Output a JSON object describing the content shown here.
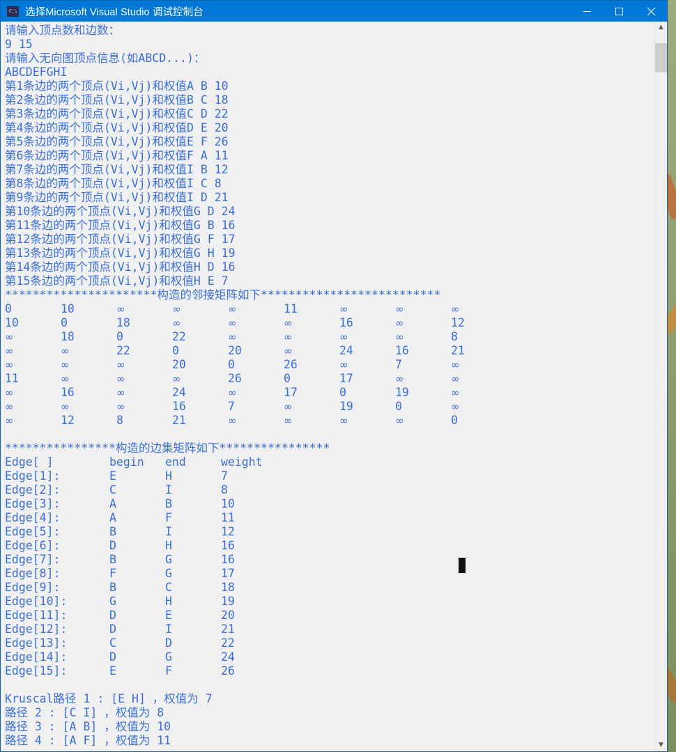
{
  "window": {
    "title": "选择Microsoft Visual Studio 调试控制台",
    "icon_label": "C:\\",
    "icon_name": "console-app-icon",
    "minimize_label": "最小化",
    "maximize_label": "最大化",
    "close_label": "关闭",
    "titlebar_color": "#0078d7",
    "text_color": "#3a6fd8",
    "background_color": "#f0f0f0"
  },
  "scrollbar": {
    "up_arrow": "▲",
    "down_arrow": "▼"
  },
  "console": {
    "prompt_vertices_edges": "请输入顶点数和边数：",
    "input_vertices_edges": "9 15",
    "prompt_vertex_info": "请输入无向图顶点信息(如ABCD...)：",
    "input_vertex_info": "ABCDEFGHI",
    "edge_prompts": [
      "第1条边的两个顶点(Vi,Vj)和权值A B 10",
      "第2条边的两个顶点(Vi,Vj)和权值B C 18",
      "第3条边的两个顶点(Vi,Vj)和权值C D 22",
      "第4条边的两个顶点(Vi,Vj)和权值D E 20",
      "第5条边的两个顶点(Vi,Vj)和权值E F 26",
      "第6条边的两个顶点(Vi,Vj)和权值F A 11",
      "第7条边的两个顶点(Vi,Vj)和权值I B 12",
      "第8条边的两个顶点(Vi,Vj)和权值I C 8",
      "第9条边的两个顶点(Vi,Vj)和权值I D 21",
      "第10条边的两个顶点(Vi,Vj)和权值G D 24",
      "第11条边的两个顶点(Vi,Vj)和权值G B 16",
      "第12条边的两个顶点(Vi,Vj)和权值G F 17",
      "第13条边的两个顶点(Vi,Vj)和权值G H 19",
      "第14条边的两个顶点(Vi,Vj)和权值H D 16",
      "第15条边的两个顶点(Vi,Vj)和权值H E 7"
    ],
    "adjacency_header": "**********************构造的邻接矩阵如下**************************",
    "edgeset_header": "****************构造的边集矩阵如下****************",
    "edge_table_header": {
      "index": "Edge[ ]",
      "begin": "begin",
      "end": "end",
      "weight": "weight"
    },
    "edge_table_rows": [
      {
        "index": "Edge[1]:",
        "begin": "E",
        "end": "H",
        "weight": "7"
      },
      {
        "index": "Edge[2]:",
        "begin": "C",
        "end": "I",
        "weight": "8"
      },
      {
        "index": "Edge[3]:",
        "begin": "A",
        "end": "B",
        "weight": "10"
      },
      {
        "index": "Edge[4]:",
        "begin": "A",
        "end": "F",
        "weight": "11"
      },
      {
        "index": "Edge[5]:",
        "begin": "B",
        "end": "I",
        "weight": "12"
      },
      {
        "index": "Edge[6]:",
        "begin": "D",
        "end": "H",
        "weight": "16"
      },
      {
        "index": "Edge[7]:",
        "begin": "B",
        "end": "G",
        "weight": "16"
      },
      {
        "index": "Edge[8]:",
        "begin": "F",
        "end": "G",
        "weight": "17"
      },
      {
        "index": "Edge[9]:",
        "begin": "B",
        "end": "C",
        "weight": "18"
      },
      {
        "index": "Edge[10]:",
        "begin": "G",
        "end": "H",
        "weight": "19"
      },
      {
        "index": "Edge[11]:",
        "begin": "D",
        "end": "E",
        "weight": "20"
      },
      {
        "index": "Edge[12]:",
        "begin": "D",
        "end": "I",
        "weight": "21"
      },
      {
        "index": "Edge[13]:",
        "begin": "C",
        "end": "D",
        "weight": "22"
      },
      {
        "index": "Edge[14]:",
        "begin": "D",
        "end": "G",
        "weight": "24"
      },
      {
        "index": "Edge[15]:",
        "begin": "E",
        "end": "F",
        "weight": "26"
      }
    ],
    "kruskal_lines": [
      "Kruscal路径 1 : [E H] ，权值为 7",
      "路径 2 : [C I] ，权值为 8",
      "路径 3 : [A B] ，权值为 10",
      "路径 4 : [A F] ，权值为 11"
    ]
  },
  "chart_data": {
    "type": "table",
    "title": "构造的邻接矩阵如下",
    "vertices": [
      "A",
      "B",
      "C",
      "D",
      "E",
      "F",
      "G",
      "H",
      "I"
    ],
    "infinity_symbol": "∞",
    "matrix": [
      [
        "0",
        "10",
        "∞",
        "∞",
        "∞",
        "11",
        "∞",
        "∞",
        "∞"
      ],
      [
        "10",
        "0",
        "18",
        "∞",
        "∞",
        "∞",
        "16",
        "∞",
        "12"
      ],
      [
        "∞",
        "18",
        "0",
        "22",
        "∞",
        "∞",
        "∞",
        "∞",
        "8"
      ],
      [
        "∞",
        "∞",
        "22",
        "0",
        "20",
        "∞",
        "24",
        "16",
        "21"
      ],
      [
        "∞",
        "∞",
        "∞",
        "20",
        "0",
        "26",
        "∞",
        "7",
        "∞"
      ],
      [
        "11",
        "∞",
        "∞",
        "∞",
        "26",
        "0",
        "17",
        "∞",
        "∞"
      ],
      [
        "∞",
        "16",
        "∞",
        "24",
        "∞",
        "17",
        "0",
        "19",
        "∞"
      ],
      [
        "∞",
        "∞",
        "∞",
        "16",
        "7",
        "∞",
        "19",
        "0",
        "∞"
      ],
      [
        "∞",
        "12",
        "8",
        "21",
        "∞",
        "∞",
        "∞",
        "∞",
        "0"
      ]
    ]
  }
}
